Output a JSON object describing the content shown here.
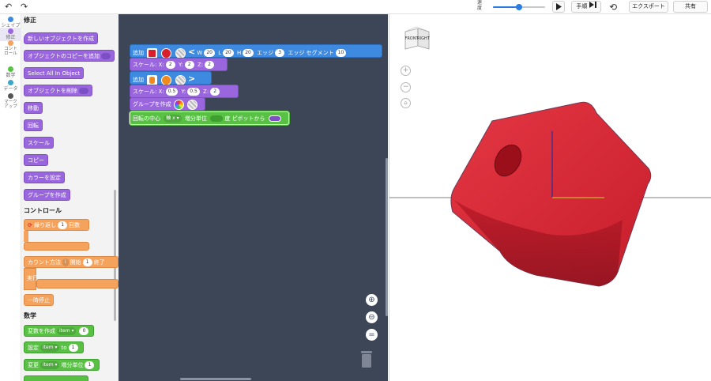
{
  "topbar": {
    "undo_icon": "undo-arrow-icon",
    "redo_icon": "redo-arrow-icon",
    "speed_label": "速度",
    "speed_value": 0.5,
    "play_icon": "play-icon",
    "step_label": "手順",
    "step_icon": "step-play-icon",
    "reset_icon": "reset-icon",
    "export_label": "エクスポート",
    "share_label": "共有"
  },
  "categories": [
    {
      "label": "シェイプ",
      "color": "#3d8ae0"
    },
    {
      "label": "修正",
      "color": "#9966dd",
      "selected": true
    },
    {
      "label": "コントロール",
      "color": "#f5a25d"
    },
    {
      "label": "数学",
      "color": "#58c144"
    },
    {
      "label": "データ",
      "color": "#3aa6c9"
    },
    {
      "label": "マークアップ",
      "color": "#555555"
    }
  ],
  "flyout": {
    "section_modify": "修正",
    "modify_blocks": [
      "新しいオブジェクトを作成",
      "オブジェクトのコピーを追加",
      "Select All In Object",
      "オブジェクトを削除",
      "移動",
      "回転",
      "スケール",
      "コピー",
      "カラーを設定",
      "グループを作成"
    ],
    "section_control": "コントロール",
    "repeat": {
      "label": "繰り返し",
      "count": "1",
      "suffix": "回数"
    },
    "count_loop": {
      "label": "カウント方法",
      "var": "i",
      "start_label": "開始",
      "start": "1",
      "end_label": "終了"
    },
    "do_label": "実行",
    "pause_label": "一時停止",
    "section_math": "数学",
    "create_var": {
      "label": "変数を作成",
      "var": "item",
      "value": "0"
    },
    "set_var": {
      "label": "設定",
      "var": "item",
      "to": "to",
      "value": "1"
    },
    "change_var": {
      "label": "変更",
      "var": "item",
      "by": "増分単位",
      "value": "1"
    }
  },
  "workspace": {
    "add1": {
      "label": "追加",
      "w_label": "W",
      "w": "20",
      "l_label": "L",
      "l": "20",
      "h_label": "H",
      "h": "20",
      "edges_label": "エッジ",
      "edges": "3",
      "segments_label": "エッジ セグメント",
      "segments": "10",
      "color": "#d8202a"
    },
    "scale1": {
      "label": "スケール:",
      "x_label": "X:",
      "x": "2",
      "y_label": "Y:",
      "y": "2",
      "z_label": "Z:",
      "z": "2"
    },
    "add2": {
      "label": "追加",
      "color": "#f08a1c"
    },
    "scale2": {
      "label": "スケール:",
      "x_label": "X:",
      "x": "0.5",
      "y_label": "Y:",
      "y": "0.5",
      "z_label": "Z:",
      "z": "2"
    },
    "group": {
      "label": "グループを作成"
    },
    "rotate": {
      "label": "回転の中心",
      "axis": "軸 x",
      "by": "増分単位",
      "unit": "度",
      "pivot": "ピボットから"
    }
  },
  "view3d": {
    "cube_front": "FRONT",
    "cube_right": "RIGHT",
    "object_color": "#d11f2e"
  }
}
